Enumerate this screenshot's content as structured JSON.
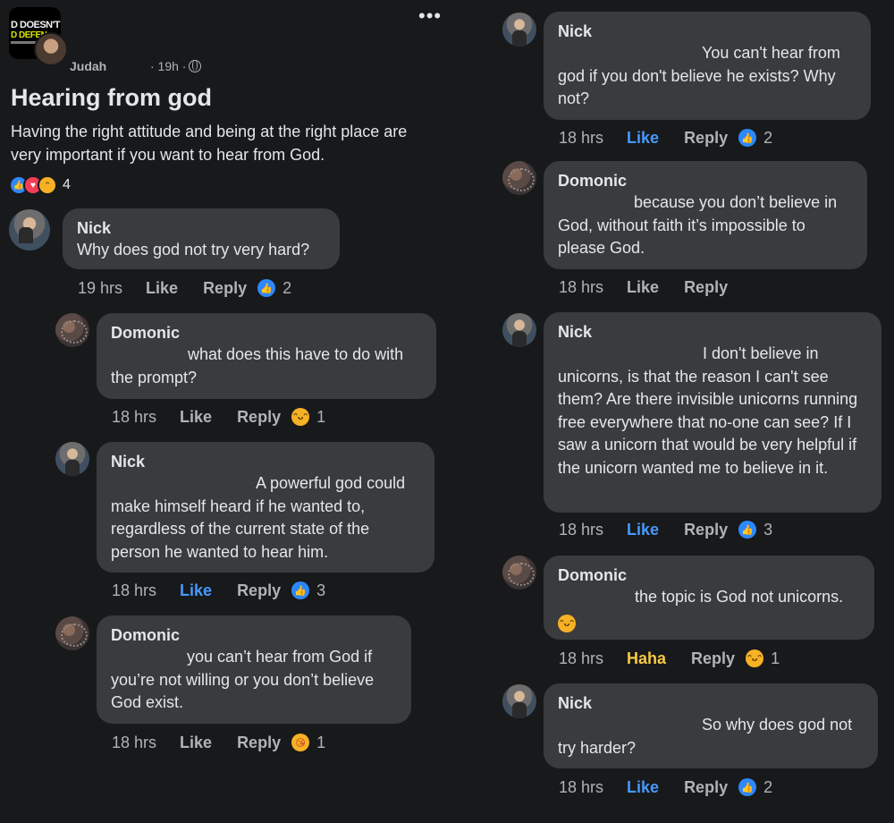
{
  "post": {
    "group_logo_line1": "D DOESN'T",
    "group_logo_line2": "D DEFEN",
    "author": "Judah",
    "time": "· 19h ·",
    "title": "Hearing from god",
    "body": "Having the right attitude and being at the right place are very important  if you want to hear from God.",
    "reaction_count": "4",
    "more_label": "•••"
  },
  "comments_left": [
    {
      "name": "Nick",
      "text": "Why does god not try very hard?",
      "time": "19 hrs",
      "like": "Like",
      "reply": "Reply",
      "count": "2"
    },
    {
      "name": "Domonic",
      "text": "what does this have to do with the prompt?",
      "time": "18 hrs",
      "like": "Like",
      "reply": "Reply",
      "count": "1"
    },
    {
      "name": "Nick",
      "text": "A powerful god could make himself heard if he wanted to, regardless of the current state of the person he wanted to hear him.",
      "time": "18 hrs",
      "like": "Like",
      "reply": "Reply",
      "count": "3"
    },
    {
      "name": "Domonic",
      "text": "you can’t hear from God if you’re not willing or you don’t believe God exist.",
      "time": "18 hrs",
      "like": "Like",
      "reply": "Reply",
      "count": "1"
    }
  ],
  "comments_right": [
    {
      "name": "Nick",
      "text": "You can't hear from god if you don't believe he exists? Why not?",
      "time": "18 hrs",
      "like": "Like",
      "reply": "Reply",
      "count": "2"
    },
    {
      "name": "Domonic",
      "text": "because you don’t believe in God, without faith it’s impossible to please God.",
      "time": "18 hrs",
      "like": "Like",
      "reply": "Reply"
    },
    {
      "name": "Nick",
      "text": "I don't believe in unicorns, is that the reason I can't see them? Are there invisible unicorns running free everywhere that no-one can see? If I saw a unicorn that would be very helpful if the unicorn wanted me to believe in it.",
      "time": "18 hrs",
      "like": "Like",
      "reply": "Reply",
      "count": "3"
    },
    {
      "name": "Domonic",
      "text": "the topic is God not unicorns.",
      "time": "18 hrs",
      "like": "Haha",
      "reply": "Reply",
      "count": "1"
    },
    {
      "name": "Nick",
      "text": "So why does god not try harder?",
      "time": "18 hrs",
      "like": "Like",
      "reply": "Reply",
      "count": "2"
    }
  ],
  "colors": {
    "background": "#18191a",
    "bubble": "#3a3b3c",
    "like_active": "#4599ff",
    "haha_active": "#f7c945"
  }
}
